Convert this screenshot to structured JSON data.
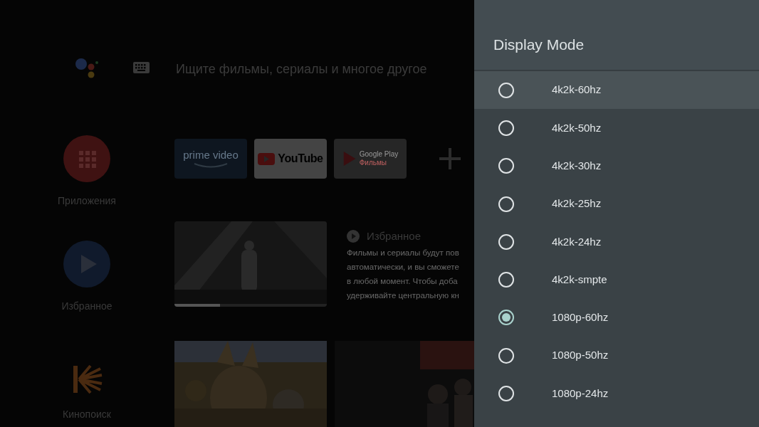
{
  "search": {
    "placeholder": "Ищите фильмы, сериалы и многое другое"
  },
  "sidebar": {
    "items": [
      {
        "kind": "apps",
        "label": "Приложения"
      },
      {
        "kind": "favorites",
        "label": "Избранное"
      },
      {
        "kind": "kinopoisk",
        "label": "Кинопоиск"
      }
    ]
  },
  "apps_row": [
    {
      "kind": "prime",
      "label": "prime video"
    },
    {
      "kind": "youtube",
      "label": "YouTube"
    },
    {
      "kind": "play",
      "label": "Google Play",
      "sublabel": "Фильмы"
    }
  ],
  "favorites": {
    "video": {
      "level": 0.3
    },
    "title": "Избранное",
    "description": [
      "Фильмы и сериалы будут пов",
      "автоматически, и вы сможете",
      "в любой момент. Чтобы доба",
      "удерживайте центральную кн"
    ]
  },
  "display_mode": {
    "title": "Display Mode",
    "options": [
      {
        "label": "4k2k-60hz",
        "selected": false,
        "focused": true
      },
      {
        "label": "4k2k-50hz",
        "selected": false,
        "focused": false
      },
      {
        "label": "4k2k-30hz",
        "selected": false,
        "focused": false
      },
      {
        "label": "4k2k-25hz",
        "selected": false,
        "focused": false
      },
      {
        "label": "4k2k-24hz",
        "selected": false,
        "focused": false
      },
      {
        "label": "4k2k-smpte",
        "selected": false,
        "focused": false
      },
      {
        "label": "1080p-60hz",
        "selected": true,
        "focused": false
      },
      {
        "label": "1080p-50hz",
        "selected": false,
        "focused": false
      },
      {
        "label": "1080p-24hz",
        "selected": false,
        "focused": false
      }
    ]
  }
}
